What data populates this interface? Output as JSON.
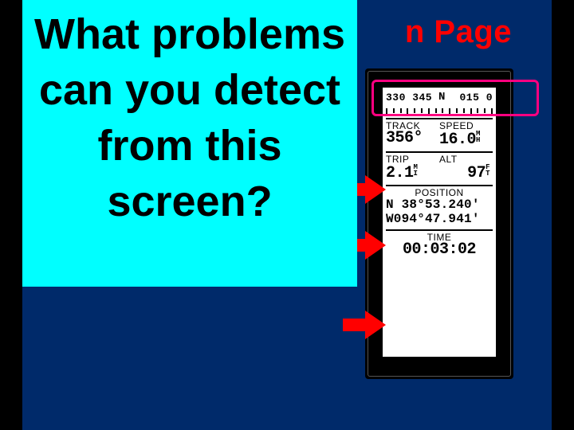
{
  "title_visible_fragment": "n Page",
  "callout": {
    "text": "What problems can you detect from this screen?"
  },
  "gps": {
    "compass": {
      "heading_strip": "330 345",
      "north_marker": "N",
      "heading_strip_right": "015 0"
    },
    "track": {
      "label": "TRACK",
      "value": "356°"
    },
    "speed": {
      "label": "SPEED",
      "value": "16.0",
      "unit_top": "M",
      "unit_bot": "H"
    },
    "trip": {
      "label": "TRIP",
      "value": "2.1",
      "unit_top": "M",
      "unit_bot": "I"
    },
    "alt": {
      "label": "ALT",
      "value": "97",
      "unit_top": "F",
      "unit_bot": "T"
    },
    "position": {
      "label": "POSITION",
      "lat": "N  38°53.240'",
      "lon": "W094°47.941'"
    },
    "time": {
      "label": "TIME",
      "value": "00:03:02"
    }
  }
}
